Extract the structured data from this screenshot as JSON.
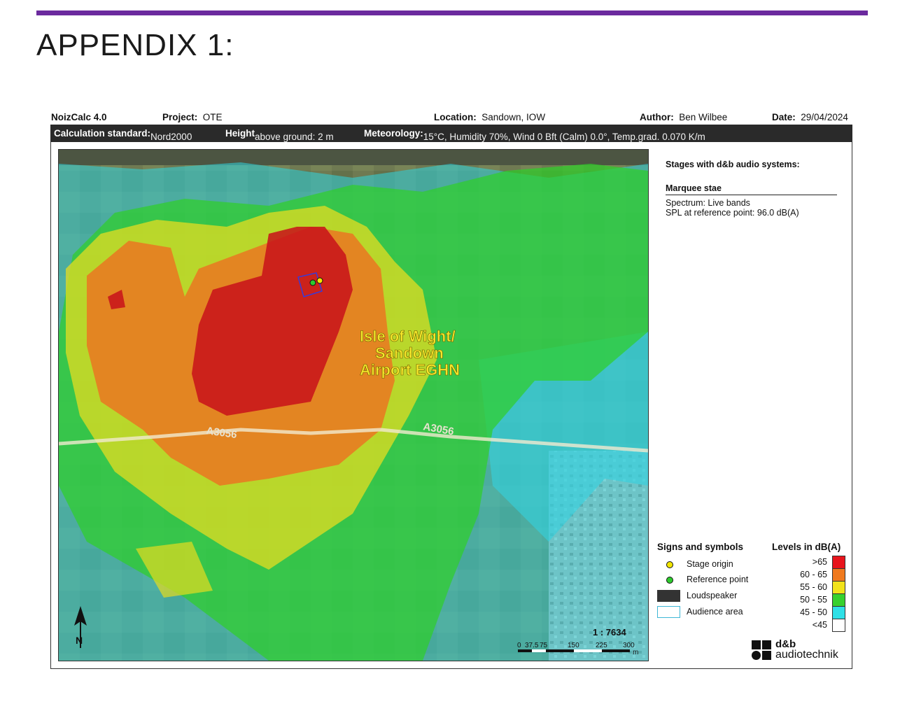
{
  "page": {
    "heading": "APPENDIX 1:",
    "accent_color": "#6b2a9e"
  },
  "header": {
    "software": "NoizCalc 4.0",
    "project_label": "Project:",
    "project_value": "OTE",
    "location_label": "Location:",
    "location_value": "Sandown, IOW",
    "author_label": "Author:",
    "author_value": "Ben Wilbee",
    "date_label": "Date:",
    "date_value": "29/04/2024"
  },
  "calc": {
    "standard_label": "Calculation standard:",
    "standard_value": "Nord2000",
    "height_label": "Height",
    "height_value": "above ground: 2 m",
    "meteo_label": "Meteorology:",
    "meteo_value": "15°C, Humidity 70%, Wind 0 Bft (Calm) 0.0°, Temp.grad. 0.070 K/m"
  },
  "map": {
    "place_label_line1": "Isle of Wight/",
    "place_label_line2": "Sandown",
    "place_label_line3": "Airport EGHN",
    "road_label_west": "A3056",
    "road_label_east": "A3056",
    "scale_text": "1 : 7634",
    "scale_ticks": [
      "0",
      "37.5",
      "75",
      "150",
      "225",
      "300"
    ],
    "scale_unit": "m",
    "north_label": "N"
  },
  "stages": {
    "title": "Stages with d&b audio systems:",
    "name": "Marquee stae",
    "spectrum": "Spectrum:  Live bands",
    "spl": "SPL at reference point:  96.0 dB(A)"
  },
  "signs": {
    "title": "Signs and symbols",
    "items": [
      {
        "label": "Stage origin",
        "color": "#f2e600"
      },
      {
        "label": "Reference point",
        "color": "#2ecc2e"
      },
      {
        "label": "Loudspeaker",
        "color": "#333333"
      },
      {
        "label": "Audience area",
        "color": "#3fb7d6"
      }
    ]
  },
  "levels": {
    "title": "Levels in dB(A)",
    "items": [
      {
        "label": ">65",
        "color": "#e8141c"
      },
      {
        "label": "60 - 65",
        "color": "#f07a1e"
      },
      {
        "label": "55 - 60",
        "color": "#f2e21a"
      },
      {
        "label": "50 - 55",
        "color": "#37d12e"
      },
      {
        "label": "45 - 50",
        "color": "#2fe0e6"
      },
      {
        "label": "<45",
        "color": "#ffffff"
      }
    ]
  },
  "brand": {
    "line1": "d&b",
    "line2": "audiotechnik"
  }
}
